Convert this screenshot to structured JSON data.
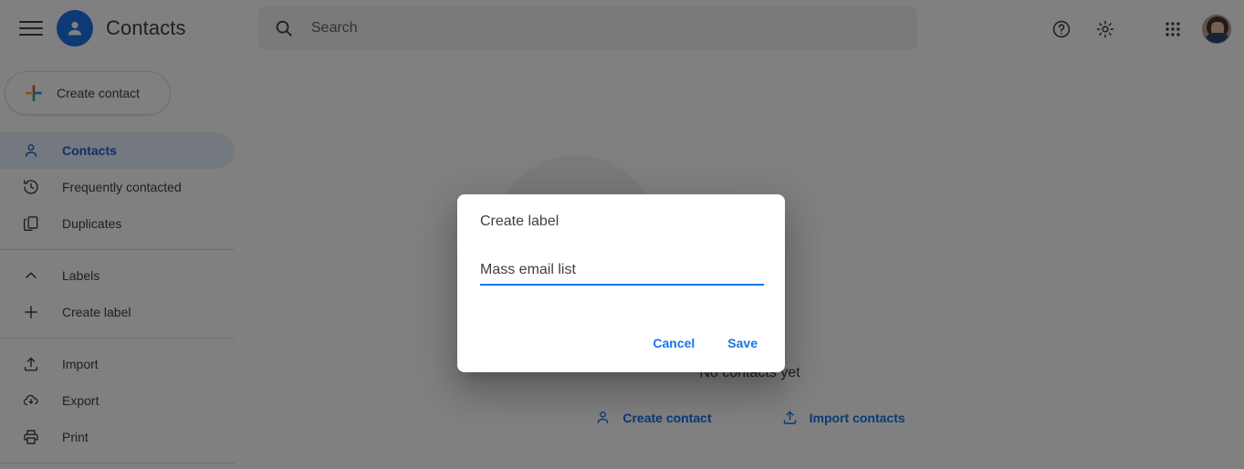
{
  "app": {
    "title": "Contacts",
    "accent_color": "#1a73e8",
    "text_color": "#3c4043",
    "selected_bg": "#e8f0fe"
  },
  "topbar": {
    "menu_icon": "hamburger-menu-icon",
    "logo_icon": "contacts-person-logo-icon",
    "title": "Contacts",
    "help_icon": "help-circle-icon",
    "settings_icon": "gear-icon",
    "apps_icon": "apps-grid-icon",
    "avatar_icon": "user-avatar-photo"
  },
  "search": {
    "placeholder": "Search",
    "value": "",
    "icon": "search-icon"
  },
  "create_contact_button": {
    "label": "Create contact",
    "icon": "google-plus-multicolor-icon"
  },
  "sidebar": {
    "items": [
      {
        "label": "Contacts",
        "icon": "person-outline-icon",
        "selected": true
      },
      {
        "label": "Frequently contacted",
        "icon": "history-clock-icon",
        "selected": false
      },
      {
        "label": "Duplicates",
        "icon": "duplicates-copy-icon",
        "selected": false
      },
      {
        "label": "Labels",
        "icon": "chevron-up-icon",
        "selected": false
      },
      {
        "label": "Create label",
        "icon": "plus-icon",
        "selected": false
      },
      {
        "label": "Import",
        "icon": "import-upload-icon",
        "selected": false
      },
      {
        "label": "Export",
        "icon": "export-cloud-download-icon",
        "selected": false
      },
      {
        "label": "Print",
        "icon": "printer-icon",
        "selected": false
      }
    ]
  },
  "empty_state": {
    "illustration_icon": "address-book-illustration",
    "title": "No contacts yet",
    "actions": [
      {
        "label": "Create contact",
        "icon": "person-add-icon"
      },
      {
        "label": "Import contacts",
        "icon": "import-upload-icon"
      }
    ]
  },
  "dialog": {
    "title": "Create label",
    "input_value": "Mass email list",
    "input_placeholder": "",
    "cancel_label": "Cancel",
    "save_label": "Save"
  }
}
